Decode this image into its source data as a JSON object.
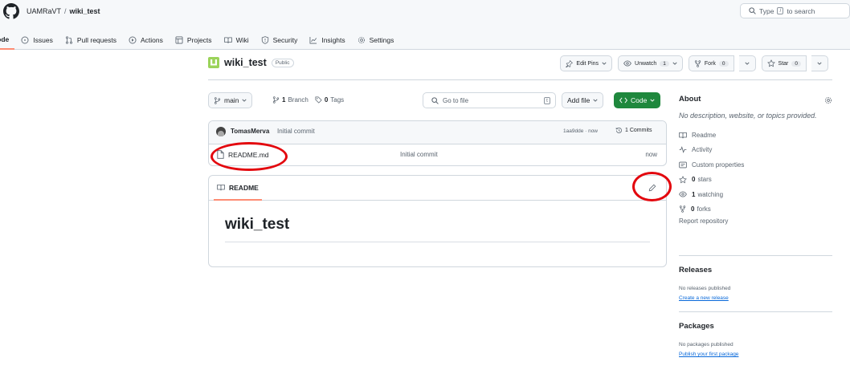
{
  "header": {
    "owner": "UAMRaVT",
    "separator": "/",
    "repo": "wiki_test",
    "search_prefix": "Type",
    "search_key": "/",
    "search_suffix": "to search"
  },
  "tabs": [
    {
      "label": "Code",
      "icon": "code-icon"
    },
    {
      "label": "Issues",
      "icon": "issue-icon"
    },
    {
      "label": "Pull requests",
      "icon": "pull-request-icon"
    },
    {
      "label": "Actions",
      "icon": "play-icon"
    },
    {
      "label": "Projects",
      "icon": "table-icon"
    },
    {
      "label": "Wiki",
      "icon": "book-icon"
    },
    {
      "label": "Security",
      "icon": "shield-icon"
    },
    {
      "label": "Insights",
      "icon": "graph-icon"
    },
    {
      "label": "Settings",
      "icon": "gear-icon"
    }
  ],
  "repo_header": {
    "name": "wiki_test",
    "visibility": "Public",
    "edit_pins": "Edit Pins",
    "unwatch": "Unwatch",
    "watch_count": "1",
    "fork": "Fork",
    "fork_count": "0",
    "star": "Star",
    "star_count": "0"
  },
  "branch_bar": {
    "branch": "main",
    "branch_count": "1",
    "branch_label": "Branch",
    "tag_count": "0",
    "tag_label": "Tags",
    "goto_placeholder": "Go to file",
    "goto_key": "t",
    "add_file": "Add file",
    "code": "Code"
  },
  "commit": {
    "author": "TomasMerva",
    "message": "Initial commit",
    "hash_time": "1aa9dde · now",
    "commits": "1 Commits"
  },
  "files": [
    {
      "name": "README.md",
      "message": "Initial commit",
      "time": "now"
    }
  ],
  "readme": {
    "tab": "README",
    "title": "wiki_test"
  },
  "about": {
    "heading": "About",
    "description": "No description, website, or topics provided.",
    "readme": "Readme",
    "activity": "Activity",
    "custom_properties": "Custom properties",
    "stars_count": "0",
    "stars_label": "stars",
    "watching_count": "1",
    "watching_label": "watching",
    "forks_count": "0",
    "forks_label": "forks",
    "report": "Report repository"
  },
  "releases": {
    "heading": "Releases",
    "empty": "No releases published",
    "link": "Create a new release"
  },
  "packages": {
    "heading": "Packages",
    "empty": "No packages published",
    "link": "Publish your first package"
  },
  "colors": {
    "accent_green": "#1f883d",
    "active_tab_underline": "#fd8c73",
    "annotation_red": "#e3070e",
    "link_blue": "#0969da"
  }
}
